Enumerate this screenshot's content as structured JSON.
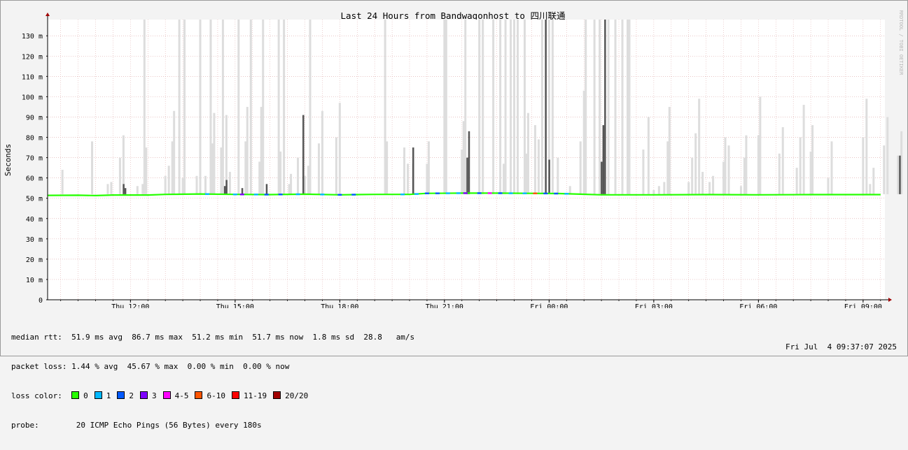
{
  "chart_data": {
    "type": "area",
    "title": "Last 24 Hours from Bandwagonhost to 四川联通",
    "ylabel": "Seconds",
    "watermark": "RRDTOOL / TOBI OETIKER",
    "ylim": [
      0,
      0.138
    ],
    "y_ticks": [
      {
        "value": 0,
        "label": "0"
      },
      {
        "value": 0.01,
        "label": "10 m"
      },
      {
        "value": 0.02,
        "label": "20 m"
      },
      {
        "value": 0.03,
        "label": "30 m"
      },
      {
        "value": 0.04,
        "label": "40 m"
      },
      {
        "value": 0.05,
        "label": "50 m"
      },
      {
        "value": 0.06,
        "label": "60 m"
      },
      {
        "value": 0.07,
        "label": "70 m"
      },
      {
        "value": 0.08,
        "label": "80 m"
      },
      {
        "value": 0.09,
        "label": "90 m"
      },
      {
        "value": 0.1,
        "label": "100 m"
      },
      {
        "value": 0.11,
        "label": "110 m"
      },
      {
        "value": 0.12,
        "label": "120 m"
      },
      {
        "value": 0.13,
        "label": "130 m"
      }
    ],
    "x_range_hours": [
      9.625,
      33.625
    ],
    "x_ticks": [
      {
        "hour": 12,
        "label": "Thu 12:00"
      },
      {
        "hour": 15,
        "label": "Thu 15:00"
      },
      {
        "hour": 18,
        "label": "Thu 18:00"
      },
      {
        "hour": 21,
        "label": "Thu 21:00"
      },
      {
        "hour": 24,
        "label": "Fri 00:00"
      },
      {
        "hour": 27,
        "label": "Fri 03:00"
      },
      {
        "hour": 30,
        "label": "Fri 06:00"
      },
      {
        "hour": 33,
        "label": "Fri 09:00"
      }
    ],
    "median_rtt_ms": [
      {
        "h": 9.63,
        "v": 51.4
      },
      {
        "h": 10.5,
        "v": 51.5
      },
      {
        "h": 11.0,
        "v": 51.3
      },
      {
        "h": 11.5,
        "v": 51.6
      },
      {
        "h": 12.5,
        "v": 51.6
      },
      {
        "h": 13.0,
        "v": 51.9
      },
      {
        "h": 14.0,
        "v": 52.1
      },
      {
        "h": 15.0,
        "v": 51.9
      },
      {
        "h": 16.0,
        "v": 51.8
      },
      {
        "h": 17.0,
        "v": 52.0
      },
      {
        "h": 18.0,
        "v": 51.7
      },
      {
        "h": 19.0,
        "v": 51.9
      },
      {
        "h": 20.0,
        "v": 51.9
      },
      {
        "h": 20.5,
        "v": 52.4
      },
      {
        "h": 21.5,
        "v": 52.5
      },
      {
        "h": 22.5,
        "v": 52.5
      },
      {
        "h": 23.5,
        "v": 52.4
      },
      {
        "h": 24.3,
        "v": 52.3
      },
      {
        "h": 24.9,
        "v": 52.0
      },
      {
        "h": 25.5,
        "v": 51.7
      },
      {
        "h": 27.0,
        "v": 51.7
      },
      {
        "h": 28.5,
        "v": 51.8
      },
      {
        "h": 30.0,
        "v": 51.7
      },
      {
        "h": 31.5,
        "v": 51.8
      },
      {
        "h": 33.5,
        "v": 51.8
      }
    ],
    "loss_segments": [
      {
        "h": 14.2,
        "loss": "1"
      },
      {
        "h": 15.0,
        "loss": "1"
      },
      {
        "h": 15.2,
        "loss": "3"
      },
      {
        "h": 15.6,
        "loss": "1"
      },
      {
        "h": 15.9,
        "loss": "2"
      },
      {
        "h": 16.3,
        "loss": "2"
      },
      {
        "h": 16.8,
        "loss": "1"
      },
      {
        "h": 17.5,
        "loss": "1"
      },
      {
        "h": 18.0,
        "loss": "2"
      },
      {
        "h": 18.4,
        "loss": "2"
      },
      {
        "h": 19.8,
        "loss": "1"
      },
      {
        "h": 20.2,
        "loss": "1"
      },
      {
        "h": 20.5,
        "loss": "2"
      },
      {
        "h": 20.8,
        "loss": "2"
      },
      {
        "h": 21.1,
        "loss": "1"
      },
      {
        "h": 21.4,
        "loss": "1"
      },
      {
        "h": 21.6,
        "loss": "3"
      },
      {
        "h": 22.0,
        "loss": "2"
      },
      {
        "h": 22.3,
        "loss": "4-5"
      },
      {
        "h": 22.6,
        "loss": "2"
      },
      {
        "h": 22.9,
        "loss": "1"
      },
      {
        "h": 23.3,
        "loss": "1"
      },
      {
        "h": 23.6,
        "loss": "6-10"
      },
      {
        "h": 23.9,
        "loss": "2"
      },
      {
        "h": 24.2,
        "loss": "2"
      },
      {
        "h": 24.5,
        "loss": "1"
      }
    ],
    "smoke_spikes_ms": [
      {
        "h": 10.05,
        "lo": 52,
        "hi": 64
      },
      {
        "h": 10.9,
        "lo": 52,
        "hi": 78
      },
      {
        "h": 11.35,
        "lo": 52,
        "hi": 57
      },
      {
        "h": 11.45,
        "lo": 52,
        "hi": 58
      },
      {
        "h": 11.7,
        "lo": 52,
        "hi": 70
      },
      {
        "h": 11.8,
        "lo": 52,
        "hi": 81
      },
      {
        "h": 12.2,
        "lo": 52,
        "hi": 56
      },
      {
        "h": 12.35,
        "lo": 52,
        "hi": 57
      },
      {
        "h": 12.4,
        "lo": 52,
        "hi": 138
      },
      {
        "h": 12.45,
        "lo": 52,
        "hi": 75
      },
      {
        "h": 13.0,
        "lo": 52,
        "hi": 61
      },
      {
        "h": 13.1,
        "lo": 52,
        "hi": 66
      },
      {
        "h": 13.2,
        "lo": 52,
        "hi": 78
      },
      {
        "h": 13.25,
        "lo": 52,
        "hi": 93
      },
      {
        "h": 13.4,
        "lo": 52,
        "hi": 138
      },
      {
        "h": 13.5,
        "lo": 52,
        "hi": 60
      },
      {
        "h": 13.55,
        "lo": 52,
        "hi": 138
      },
      {
        "h": 13.9,
        "lo": 52,
        "hi": 61
      },
      {
        "h": 14.0,
        "lo": 52,
        "hi": 138
      },
      {
        "h": 14.15,
        "lo": 52,
        "hi": 61
      },
      {
        "h": 14.3,
        "lo": 52,
        "hi": 138
      },
      {
        "h": 14.35,
        "lo": 52,
        "hi": 77
      },
      {
        "h": 14.4,
        "lo": 52,
        "hi": 92
      },
      {
        "h": 14.6,
        "lo": 52,
        "hi": 75
      },
      {
        "h": 14.65,
        "lo": 52,
        "hi": 138
      },
      {
        "h": 14.75,
        "lo": 52,
        "hi": 91
      },
      {
        "h": 14.85,
        "lo": 52,
        "hi": 63
      },
      {
        "h": 15.1,
        "lo": 52,
        "hi": 138
      },
      {
        "h": 15.3,
        "lo": 52,
        "hi": 78
      },
      {
        "h": 15.35,
        "lo": 52,
        "hi": 95
      },
      {
        "h": 15.45,
        "lo": 52,
        "hi": 138
      },
      {
        "h": 15.7,
        "lo": 52,
        "hi": 68
      },
      {
        "h": 15.75,
        "lo": 52,
        "hi": 95
      },
      {
        "h": 15.8,
        "lo": 52,
        "hi": 138
      },
      {
        "h": 16.25,
        "lo": 52,
        "hi": 138
      },
      {
        "h": 16.3,
        "lo": 52,
        "hi": 73
      },
      {
        "h": 16.4,
        "lo": 52,
        "hi": 138
      },
      {
        "h": 16.55,
        "lo": 52,
        "hi": 57
      },
      {
        "h": 16.6,
        "lo": 52,
        "hi": 62
      },
      {
        "h": 16.8,
        "lo": 52,
        "hi": 70
      },
      {
        "h": 17.0,
        "lo": 52,
        "hi": 61
      },
      {
        "h": 17.1,
        "lo": 52,
        "hi": 66
      },
      {
        "h": 17.15,
        "lo": 52,
        "hi": 138
      },
      {
        "h": 17.4,
        "lo": 52,
        "hi": 77
      },
      {
        "h": 17.5,
        "lo": 52,
        "hi": 93
      },
      {
        "h": 17.9,
        "lo": 52,
        "hi": 80
      },
      {
        "h": 18.0,
        "lo": 52,
        "hi": 97
      },
      {
        "h": 19.3,
        "lo": 52,
        "hi": 138
      },
      {
        "h": 19.35,
        "lo": 52,
        "hi": 78
      },
      {
        "h": 19.85,
        "lo": 52,
        "hi": 75
      },
      {
        "h": 19.95,
        "lo": 52,
        "hi": 67
      },
      {
        "h": 20.1,
        "lo": 52,
        "hi": 67
      },
      {
        "h": 20.5,
        "lo": 52,
        "hi": 67
      },
      {
        "h": 20.55,
        "lo": 52,
        "hi": 78
      },
      {
        "h": 21.0,
        "lo": 52,
        "hi": 138
      },
      {
        "h": 21.05,
        "lo": 52,
        "hi": 138
      },
      {
        "h": 21.5,
        "lo": 52,
        "hi": 74
      },
      {
        "h": 21.55,
        "lo": 52,
        "hi": 88
      },
      {
        "h": 21.6,
        "lo": 52,
        "hi": 138
      },
      {
        "h": 22.0,
        "lo": 52,
        "hi": 138
      },
      {
        "h": 22.1,
        "lo": 52,
        "hi": 138
      },
      {
        "h": 22.4,
        "lo": 52,
        "hi": 138
      },
      {
        "h": 22.6,
        "lo": 52,
        "hi": 138
      },
      {
        "h": 22.7,
        "lo": 52,
        "hi": 67
      },
      {
        "h": 22.75,
        "lo": 52,
        "hi": 138
      },
      {
        "h": 22.9,
        "lo": 52,
        "hi": 138
      },
      {
        "h": 23.0,
        "lo": 52,
        "hi": 138
      },
      {
        "h": 23.1,
        "lo": 52,
        "hi": 138
      },
      {
        "h": 23.3,
        "lo": 52,
        "hi": 138
      },
      {
        "h": 23.35,
        "lo": 52,
        "hi": 72
      },
      {
        "h": 23.4,
        "lo": 52,
        "hi": 92
      },
      {
        "h": 23.6,
        "lo": 52,
        "hi": 86
      },
      {
        "h": 23.7,
        "lo": 52,
        "hi": 79
      },
      {
        "h": 23.8,
        "lo": 52,
        "hi": 138
      },
      {
        "h": 24.0,
        "lo": 52,
        "hi": 138
      },
      {
        "h": 24.1,
        "lo": 52,
        "hi": 138
      },
      {
        "h": 24.25,
        "lo": 52,
        "hi": 70
      },
      {
        "h": 24.6,
        "lo": 52,
        "hi": 56
      },
      {
        "h": 24.9,
        "lo": 52,
        "hi": 78
      },
      {
        "h": 25.0,
        "lo": 52,
        "hi": 103
      },
      {
        "h": 25.05,
        "lo": 52,
        "hi": 138
      },
      {
        "h": 25.3,
        "lo": 52,
        "hi": 138
      },
      {
        "h": 25.45,
        "lo": 52,
        "hi": 138
      },
      {
        "h": 25.7,
        "lo": 52,
        "hi": 138
      },
      {
        "h": 25.9,
        "lo": 52,
        "hi": 138
      },
      {
        "h": 26.1,
        "lo": 52,
        "hi": 138
      },
      {
        "h": 26.25,
        "lo": 52,
        "hi": 138
      },
      {
        "h": 26.3,
        "lo": 52,
        "hi": 138
      },
      {
        "h": 26.7,
        "lo": 52,
        "hi": 74
      },
      {
        "h": 26.85,
        "lo": 52,
        "hi": 90
      },
      {
        "h": 27.0,
        "lo": 52,
        "hi": 54
      },
      {
        "h": 27.15,
        "lo": 52,
        "hi": 56
      },
      {
        "h": 27.3,
        "lo": 52,
        "hi": 58
      },
      {
        "h": 27.4,
        "lo": 52,
        "hi": 78
      },
      {
        "h": 27.45,
        "lo": 52,
        "hi": 95
      },
      {
        "h": 28.0,
        "lo": 52,
        "hi": 58
      },
      {
        "h": 28.1,
        "lo": 52,
        "hi": 70
      },
      {
        "h": 28.2,
        "lo": 52,
        "hi": 82
      },
      {
        "h": 28.3,
        "lo": 52,
        "hi": 99
      },
      {
        "h": 28.4,
        "lo": 52,
        "hi": 63
      },
      {
        "h": 28.6,
        "lo": 52,
        "hi": 58
      },
      {
        "h": 28.7,
        "lo": 52,
        "hi": 61
      },
      {
        "h": 29.0,
        "lo": 52,
        "hi": 68
      },
      {
        "h": 29.05,
        "lo": 52,
        "hi": 80
      },
      {
        "h": 29.15,
        "lo": 52,
        "hi": 76
      },
      {
        "h": 29.5,
        "lo": 52,
        "hi": 56
      },
      {
        "h": 29.6,
        "lo": 52,
        "hi": 70
      },
      {
        "h": 29.65,
        "lo": 52,
        "hi": 81
      },
      {
        "h": 30.0,
        "lo": 52,
        "hi": 81
      },
      {
        "h": 30.05,
        "lo": 52,
        "hi": 100
      },
      {
        "h": 30.6,
        "lo": 52,
        "hi": 72
      },
      {
        "h": 30.7,
        "lo": 52,
        "hi": 85
      },
      {
        "h": 31.1,
        "lo": 52,
        "hi": 65
      },
      {
        "h": 31.2,
        "lo": 52,
        "hi": 80
      },
      {
        "h": 31.3,
        "lo": 52,
        "hi": 96
      },
      {
        "h": 31.5,
        "lo": 52,
        "hi": 73
      },
      {
        "h": 31.55,
        "lo": 52,
        "hi": 86
      },
      {
        "h": 32.0,
        "lo": 52,
        "hi": 60
      },
      {
        "h": 32.1,
        "lo": 52,
        "hi": 78
      },
      {
        "h": 33.0,
        "lo": 52,
        "hi": 80
      },
      {
        "h": 33.1,
        "lo": 52,
        "hi": 99
      },
      {
        "h": 33.2,
        "lo": 52,
        "hi": 57
      },
      {
        "h": 33.3,
        "lo": 52,
        "hi": 65
      },
      {
        "h": 33.6,
        "lo": 52,
        "hi": 76
      },
      {
        "h": 33.7,
        "lo": 52,
        "hi": 90
      },
      {
        "h": 34.0,
        "lo": 52,
        "hi": 71
      },
      {
        "h": 34.1,
        "lo": 52,
        "hi": 83
      }
    ],
    "dark_spikes_ms": [
      {
        "h": 11.8,
        "lo": 52,
        "hi": 57
      },
      {
        "h": 11.85,
        "lo": 52,
        "hi": 55
      },
      {
        "h": 14.7,
        "lo": 52,
        "hi": 56
      },
      {
        "h": 14.75,
        "lo": 52,
        "hi": 59
      },
      {
        "h": 15.2,
        "lo": 52,
        "hi": 55
      },
      {
        "h": 15.9,
        "lo": 52,
        "hi": 57
      },
      {
        "h": 16.95,
        "lo": 52,
        "hi": 91
      },
      {
        "h": 20.1,
        "lo": 52,
        "hi": 75
      },
      {
        "h": 21.65,
        "lo": 52,
        "hi": 70
      },
      {
        "h": 21.7,
        "lo": 52,
        "hi": 83
      },
      {
        "h": 23.9,
        "lo": 52,
        "hi": 138
      },
      {
        "h": 24.0,
        "lo": 52,
        "hi": 69
      },
      {
        "h": 25.5,
        "lo": 52,
        "hi": 68
      },
      {
        "h": 25.55,
        "lo": 52,
        "hi": 86
      },
      {
        "h": 25.6,
        "lo": 52,
        "hi": 138
      },
      {
        "h": 34.05,
        "lo": 52,
        "hi": 71
      }
    ]
  },
  "stats": {
    "median_rtt_label": "median rtt:",
    "median_rtt_values": "51.9 ms avg  86.7 ms max  51.2 ms min  51.7 ms now  1.8 ms sd  28.8   am/s",
    "packet_loss_label": "packet loss:",
    "packet_loss_values": "1.44 % avg  45.67 % max  0.00 % min  0.00 % now",
    "loss_color_label": "loss color:",
    "loss_colors": [
      {
        "label": "0",
        "color": "#26ff00"
      },
      {
        "label": "1",
        "color": "#00b8ff"
      },
      {
        "label": "2",
        "color": "#0059ff"
      },
      {
        "label": "3",
        "color": "#7e00ff"
      },
      {
        "label": "4-5",
        "color": "#ff00ff"
      },
      {
        "label": "6-10",
        "color": "#ff5500"
      },
      {
        "label": "11-19",
        "color": "#ff0000"
      },
      {
        "label": "20/20",
        "color": "#a10000"
      }
    ],
    "probe_label": "probe:",
    "probe_value": "20 ICMP Echo Pings (56 Bytes) every 180s",
    "datestamp": "Fri Jul  4 09:37:07 2025"
  },
  "colors": {
    "plot_bg": "#ffffff",
    "frame_bg": "#f3f3f3",
    "grid": "#e0b0b0",
    "smoke_light": "#dddddd",
    "smoke_dark": "#555555",
    "median_line": "#26ff00"
  }
}
